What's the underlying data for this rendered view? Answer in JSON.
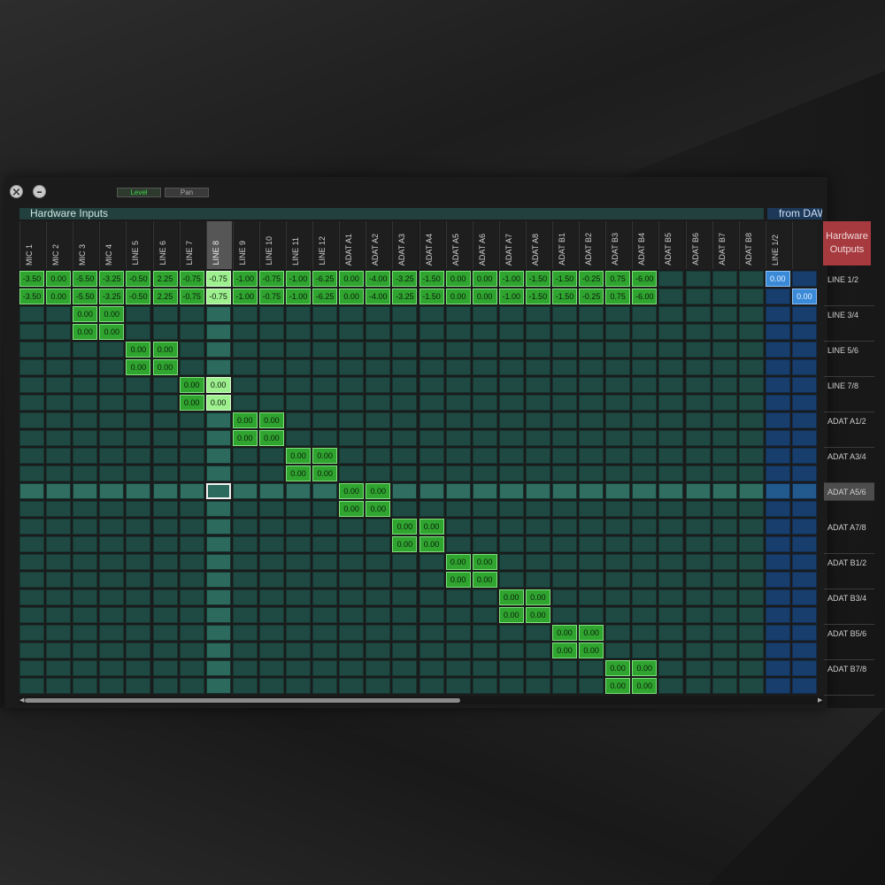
{
  "toolbar": {
    "level_label": "Level",
    "pan_label": "Pan"
  },
  "sections": {
    "hardware_inputs": "Hardware Inputs",
    "from_daw": "from DAW"
  },
  "hardware_outputs_label": "Hardware Outputs",
  "columns": [
    "MIC 1",
    "MIC 2",
    "MIC 3",
    "MIC 4",
    "LINE 5",
    "LINE 6",
    "LINE 7",
    "LINE 8",
    "LINE 9",
    "LINE 10",
    "LINE 11",
    "LINE 12",
    "ADAT A1",
    "ADAT A2",
    "ADAT A3",
    "ADAT A4",
    "ADAT A5",
    "ADAT A6",
    "ADAT A7",
    "ADAT A8",
    "ADAT B1",
    "ADAT B2",
    "ADAT B3",
    "ADAT B4",
    "ADAT B5",
    "ADAT B6",
    "ADAT B7",
    "ADAT B8",
    "LINE 1/2",
    ""
  ],
  "selected_column": "LINE 8",
  "row_labels": [
    "LINE 1/2",
    "LINE 3/4",
    "LINE 5/6",
    "LINE 7/8",
    "ADAT A1/2",
    "ADAT A3/4",
    "ADAT A5/6",
    "ADAT A7/8",
    "ADAT B1/2",
    "ADAT B3/4",
    "ADAT B5/6",
    "ADAT B7/8"
  ],
  "selected_row_label": "ADAT A5/6",
  "row1_values": [
    "-3.50",
    "0.00",
    "-5.50",
    "-3.25",
    "-0.50",
    "2.25",
    "-0.75",
    "-0.75",
    "-1.00",
    "-0.75",
    "-1.00",
    "-6.25",
    "0.00",
    "-4.00",
    "-3.25",
    "-1.50",
    "0.00",
    "0.00",
    "-1.00",
    "-1.50",
    "-1.50",
    "-0.25",
    "0.75",
    "-6.00"
  ],
  "row2_values": [
    "-3.50",
    "0.00",
    "-5.50",
    "-3.25",
    "-0.50",
    "2.25",
    "-0.75",
    "-0.75",
    "-1.00",
    "-0.75",
    "-1.00",
    "-6.25",
    "0.00",
    "-4.00",
    "-3.25",
    "-1.50",
    "0.00",
    "0.00",
    "-1.00",
    "-1.50",
    "-1.50",
    "-0.25",
    "0.75",
    "-6.00"
  ],
  "daw_values": {
    "row1": "0.00",
    "row2": "0.00"
  },
  "diag_value": "0.00",
  "colors": {
    "cell": "#1f4a43",
    "active": "#2fa42f",
    "daw": "#173e6c",
    "outputs_button": "#a63a3f"
  }
}
